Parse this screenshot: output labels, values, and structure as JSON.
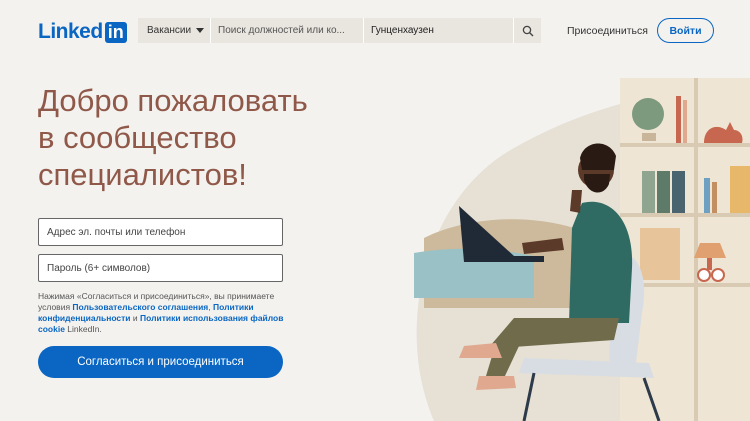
{
  "header": {
    "logo_text": "Linked",
    "logo_box": "in",
    "search": {
      "category": "Вакансии",
      "query_placeholder": "Поиск должностей или ко...",
      "location": "Гунценхаузен"
    },
    "join_label": "Присоединиться",
    "signin_label": "Войти"
  },
  "hero": {
    "title_lines": [
      "Добро пожаловать",
      "в сообщество",
      "специалистов!"
    ],
    "email_placeholder": "Адрес эл. почты или телефон",
    "password_placeholder": "Пароль (6+ символов)",
    "terms": {
      "part1": "Нажимая «Согласиться и присоединиться», вы принимаете условия ",
      "link1": "Пользовательского соглашения",
      "part2": ", ",
      "link2": "Политики конфиденциальности",
      "part3": " и ",
      "link3": "Политики использования файлов cookie",
      "part4": " LinkedIn."
    },
    "join_button": "Согласиться и присоединиться"
  },
  "colors": {
    "brand": "#0a66c2",
    "title": "#8f5849",
    "background": "#f3f2ef"
  }
}
